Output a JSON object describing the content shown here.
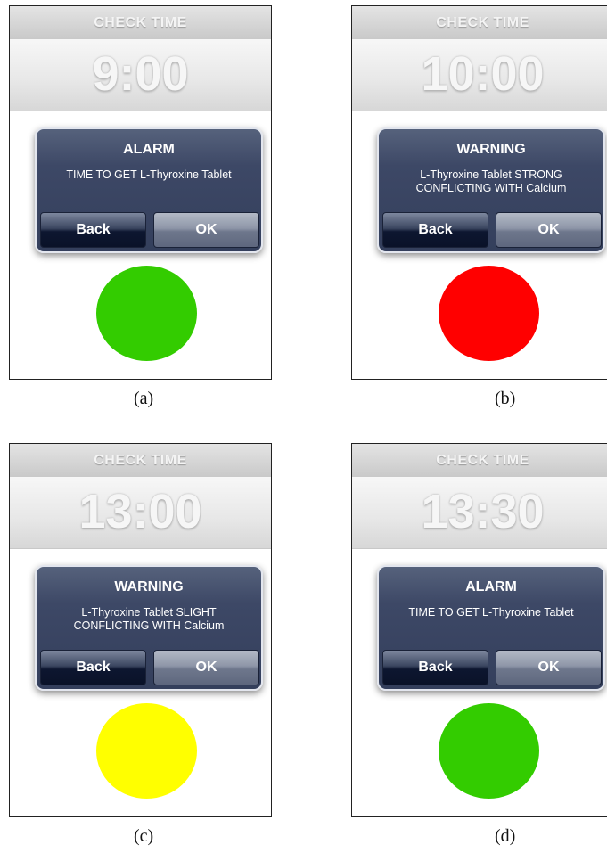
{
  "colors": {
    "green": "#33cc00",
    "red": "#ff0000",
    "yellow": "#ffff00",
    "dialog_bg": "#3a4562"
  },
  "panels": [
    {
      "caption": "(a)",
      "header": "CHECK TIME",
      "time": "9:00",
      "dialog": {
        "title": "ALARM",
        "message": "TIME TO GET L-Thyroxine Tablet",
        "back_label": "Back",
        "ok_label": "OK"
      },
      "indicator_color": "#33cc00"
    },
    {
      "caption": "(b)",
      "header": "CHECK TIME",
      "time": "10:00",
      "dialog": {
        "title": "WARNING",
        "message": "L-Thyroxine Tablet STRONG CONFLICTING WITH Calcium",
        "back_label": "Back",
        "ok_label": "OK"
      },
      "indicator_color": "#ff0000"
    },
    {
      "caption": "(c)",
      "header": "CHECK TIME",
      "time": "13:00",
      "dialog": {
        "title": "WARNING",
        "message": "L-Thyroxine Tablet SLIGHT CONFLICTING WITH Calcium",
        "back_label": "Back",
        "ok_label": "OK"
      },
      "indicator_color": "#ffff00"
    },
    {
      "caption": "(d)",
      "header": "CHECK TIME",
      "time": "13:30",
      "dialog": {
        "title": "ALARM",
        "message": "TIME TO GET L-Thyroxine Tablet",
        "back_label": "Back",
        "ok_label": "OK"
      },
      "indicator_color": "#33cc00"
    }
  ]
}
